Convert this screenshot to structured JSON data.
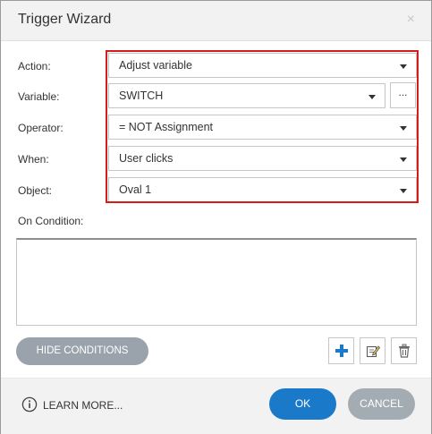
{
  "dialog": {
    "title": "Trigger Wizard",
    "close_glyph": "×"
  },
  "form": {
    "action_label": "Action:",
    "action_value": "Adjust variable",
    "variable_label": "Variable:",
    "variable_value": "SWITCH",
    "browse_glyph": "...",
    "operator_label": "Operator:",
    "operator_value": "= NOT Assignment",
    "when_label": "When:",
    "when_value": "User clicks",
    "object_label": "Object:",
    "object_value": "Oval 1",
    "condition_label": "On Condition:"
  },
  "conditions": {
    "hide_label": "HIDE CONDITIONS"
  },
  "footer": {
    "learn_more": "LEARN MORE...",
    "ok": "OK",
    "cancel": "CANCEL"
  },
  "icons": {
    "add": "plus-icon",
    "edit": "edit-icon",
    "delete": "trash-icon",
    "info": "info-icon"
  },
  "colors": {
    "highlight": "#d71a1a",
    "ok": "#1a7ac9",
    "cancel": "#a4acb3",
    "hide": "#9aa3ab",
    "add_icon": "#1a7ac9"
  }
}
